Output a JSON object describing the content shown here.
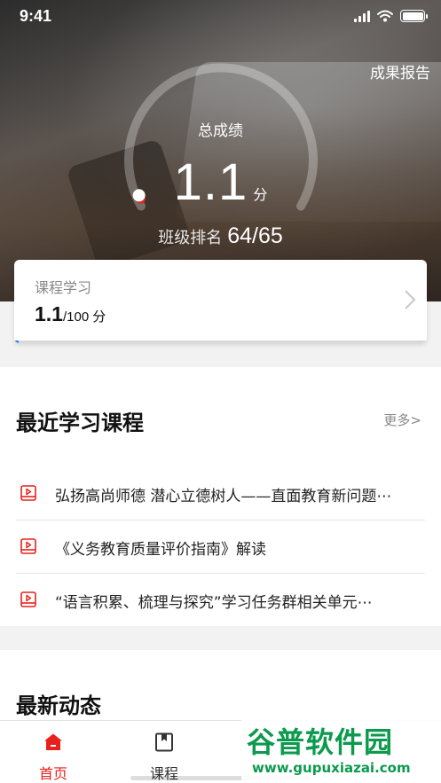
{
  "status_bar": {
    "time": "9:41"
  },
  "header": {
    "report_link": "成果报告",
    "total_label": "总成绩",
    "score": "1.1",
    "score_unit": "分",
    "gauge_fraction": 0.011,
    "rank_label": "班级排名",
    "rank_value": "64/65"
  },
  "course_card": {
    "title": "课程学习",
    "score": "1.1",
    "max": "/100",
    "unit": "分",
    "progress_fraction": 0.011
  },
  "recent": {
    "title": "最近学习课程",
    "more": "更多>",
    "items": [
      {
        "label": "弘扬高尚师德 潜心立德树人——直面教育新问题⋯"
      },
      {
        "label": "《义务教育质量评价指南》解读"
      },
      {
        "label": "“语言积累、梳理与探究”学习任务群相关单元⋯"
      }
    ]
  },
  "news": {
    "title": "最新动态"
  },
  "tab_bar": {
    "tabs": [
      {
        "label": "首页",
        "active": true
      },
      {
        "label": "课程",
        "active": false
      }
    ]
  },
  "watermark": {
    "logo": "谷普软件园",
    "url": "www.gupuxiazai.com"
  },
  "colors": {
    "accent": "#e8211c",
    "progress": "#1e8fe8",
    "watermark": "#0c9a4d"
  }
}
